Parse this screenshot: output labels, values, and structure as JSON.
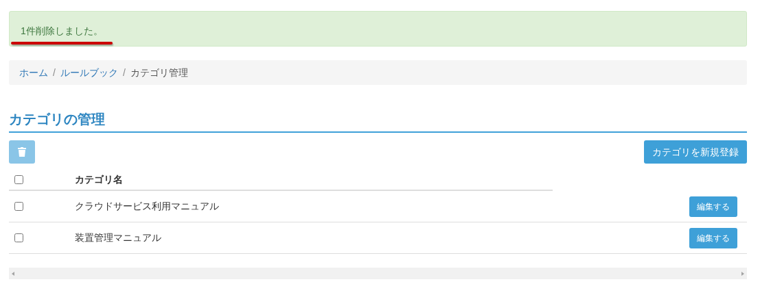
{
  "alert": {
    "message": "1件削除しました。"
  },
  "breadcrumb": [
    {
      "label": "ホーム",
      "link": true
    },
    {
      "separator": "/",
      "label": "ルールブック",
      "link": true
    },
    {
      "separator": "/",
      "label": "カテゴリ管理",
      "link": false
    }
  ],
  "heading": "カテゴリの管理",
  "toolbar": {
    "delete_disabled": true,
    "create_button": "カテゴリを新規登録"
  },
  "table": {
    "select_all_checked": false,
    "columns": [
      "カテゴリ名"
    ],
    "rows": [
      {
        "name": "クラウドサービス利用マニュアル",
        "checked": false,
        "action": "編集する"
      },
      {
        "name": "装置管理マニュアル",
        "checked": false,
        "action": "編集する"
      }
    ]
  }
}
